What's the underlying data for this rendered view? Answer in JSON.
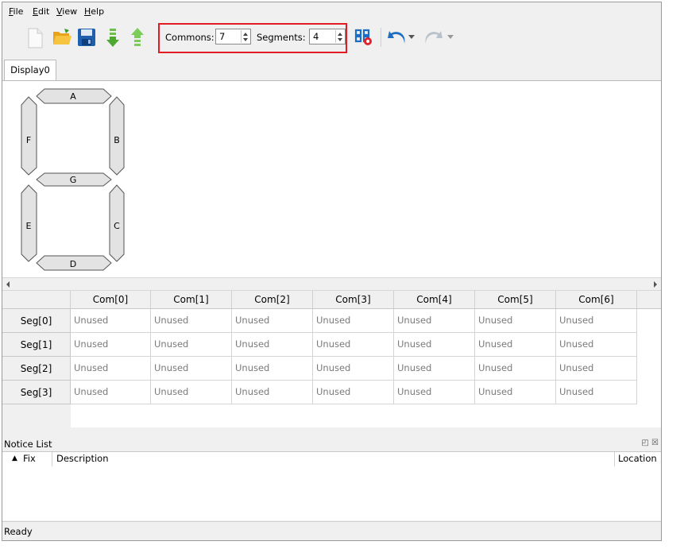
{
  "menu": {
    "file": "File",
    "edit": "Edit",
    "view": "View",
    "help": "Help"
  },
  "toolbar": {
    "commons_label": "Commons:",
    "commons_value": "7",
    "segments_label": "Segments:",
    "segments_value": "4",
    "icons": [
      "new-file-icon",
      "open-folder-icon",
      "save-icon",
      "import-arrow-icon",
      "export-arrow-icon",
      "segment-settings-icon",
      "undo-icon",
      "redo-icon"
    ]
  },
  "tabs": [
    {
      "label": "Display0"
    }
  ],
  "display": {
    "segments": [
      "A",
      "B",
      "C",
      "D",
      "E",
      "F",
      "G"
    ],
    "segment_fill": "#e3e3e3"
  },
  "grid": {
    "columns": [
      "Com[0]",
      "Com[1]",
      "Com[2]",
      "Com[3]",
      "Com[4]",
      "Com[5]",
      "Com[6]"
    ],
    "rows": [
      {
        "label": "Seg[0]",
        "cells": [
          "Unused",
          "Unused",
          "Unused",
          "Unused",
          "Unused",
          "Unused",
          "Unused"
        ]
      },
      {
        "label": "Seg[1]",
        "cells": [
          "Unused",
          "Unused",
          "Unused",
          "Unused",
          "Unused",
          "Unused",
          "Unused"
        ]
      },
      {
        "label": "Seg[2]",
        "cells": [
          "Unused",
          "Unused",
          "Unused",
          "Unused",
          "Unused",
          "Unused",
          "Unused"
        ]
      },
      {
        "label": "Seg[3]",
        "cells": [
          "Unused",
          "Unused",
          "Unused",
          "Unused",
          "Unused",
          "Unused",
          "Unused"
        ]
      }
    ]
  },
  "notice": {
    "title": "Notice List",
    "col_fix": "Fix",
    "col_description": "Description",
    "col_location": "Location"
  },
  "status": {
    "text": "Ready"
  },
  "colors": {
    "highlight": "#e31b23",
    "accent_blue": "#1e6fc2",
    "accent_green": "#5cae3c"
  }
}
